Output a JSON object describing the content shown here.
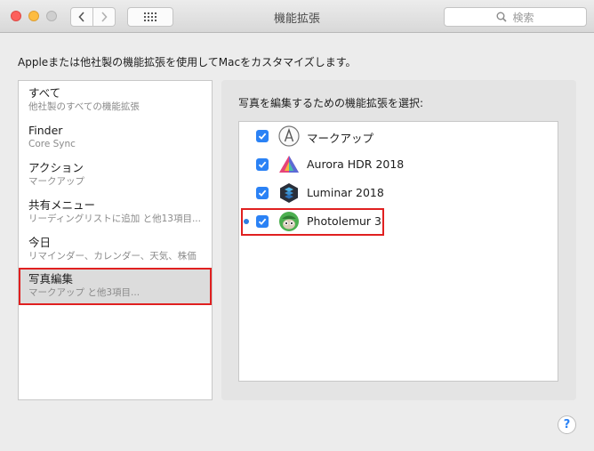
{
  "window": {
    "title": "機能拡張",
    "search_placeholder": "検索"
  },
  "description": "Appleまたは他社製の機能拡張を使用してMacをカスタマイズします。",
  "categories": [
    {
      "title": "すべて",
      "subtitle": "他社製のすべての機能拡張"
    },
    {
      "title": "Finder",
      "subtitle": "Core Sync"
    },
    {
      "title": "アクション",
      "subtitle": "マークアップ"
    },
    {
      "title": "共有メニュー",
      "subtitle": "リーディングリストに追加 と他13項目..."
    },
    {
      "title": "今日",
      "subtitle": "リマインダー、カレンダー、天気、株価"
    },
    {
      "title": "写真編集",
      "subtitle": "マークアップ と他3項目...",
      "selected": true
    }
  ],
  "panel": {
    "heading": "写真を編集するための機能拡張を選択:",
    "extensions": [
      {
        "name": "マークアップ",
        "checked": true,
        "icon": "markup-icon"
      },
      {
        "name": "Aurora HDR 2018",
        "checked": true,
        "icon": "aurora-hdr-icon"
      },
      {
        "name": "Luminar 2018",
        "checked": true,
        "icon": "luminar-icon"
      },
      {
        "name": "Photolemur 3",
        "checked": true,
        "icon": "photolemur-icon",
        "new": true
      }
    ]
  },
  "help_label": "?",
  "colors": {
    "accent": "#2b82f5",
    "highlight_outline": "#e02020"
  }
}
